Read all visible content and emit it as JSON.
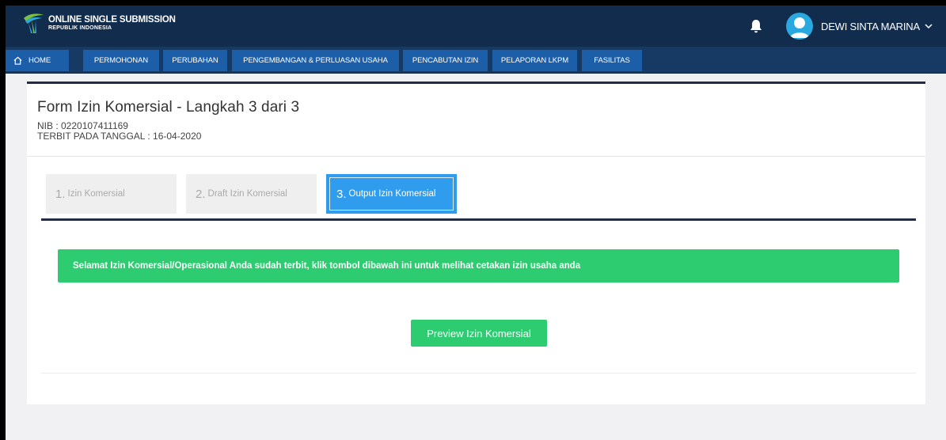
{
  "header": {
    "logo_title": "ONLINE SINGLE SUBMISSION",
    "logo_subtitle": "REPUBLIK INDONESIA",
    "logo_icon": "oss-emblem-icon",
    "notification_icon": "bell-icon",
    "user_name": "DEWI SINTA MARINA",
    "user_menu_icon": "chevron-down-icon",
    "avatar_color": "#29a9e0"
  },
  "nav": {
    "items": [
      {
        "label": "HOME",
        "icon": "home-icon"
      },
      {
        "label": "PERMOHONAN"
      },
      {
        "label": "PERUBAHAN"
      },
      {
        "label": "PENGEMBANGAN & PERLUASAN USAHA"
      },
      {
        "label": "PENCABUTAN IZIN"
      },
      {
        "label": "PELAPORAN LKPM"
      },
      {
        "label": "FASILITAS"
      }
    ]
  },
  "form": {
    "title": "Form Izin Komersial - Langkah 3 dari 3",
    "nib": "NIB : 0220107411169",
    "issued": "TERBIT PADA TANGGAL : 16-04-2020"
  },
  "steps": [
    {
      "num": "1.",
      "label": "Izin Komersial",
      "active": false
    },
    {
      "num": "2.",
      "label": "Draft Izin Komersial",
      "active": false
    },
    {
      "num": "3.",
      "label": "Output Izin Komersial",
      "active": true
    }
  ],
  "alert": {
    "message": "Selamat Izin Komersial/Operasional Anda sudah terbit, klik tombol dibawah ini untuk melihat cetakan izin usaha anda",
    "color": "#2ecc71"
  },
  "actions": {
    "preview_label": "Preview Izin Komersial"
  },
  "colors": {
    "header_bg": "#122c4d",
    "nav_bg": "#163a63",
    "nav_item_bg": "#1c5fa8",
    "active_step": "#2f9cee",
    "accent_line": "#232c45"
  }
}
